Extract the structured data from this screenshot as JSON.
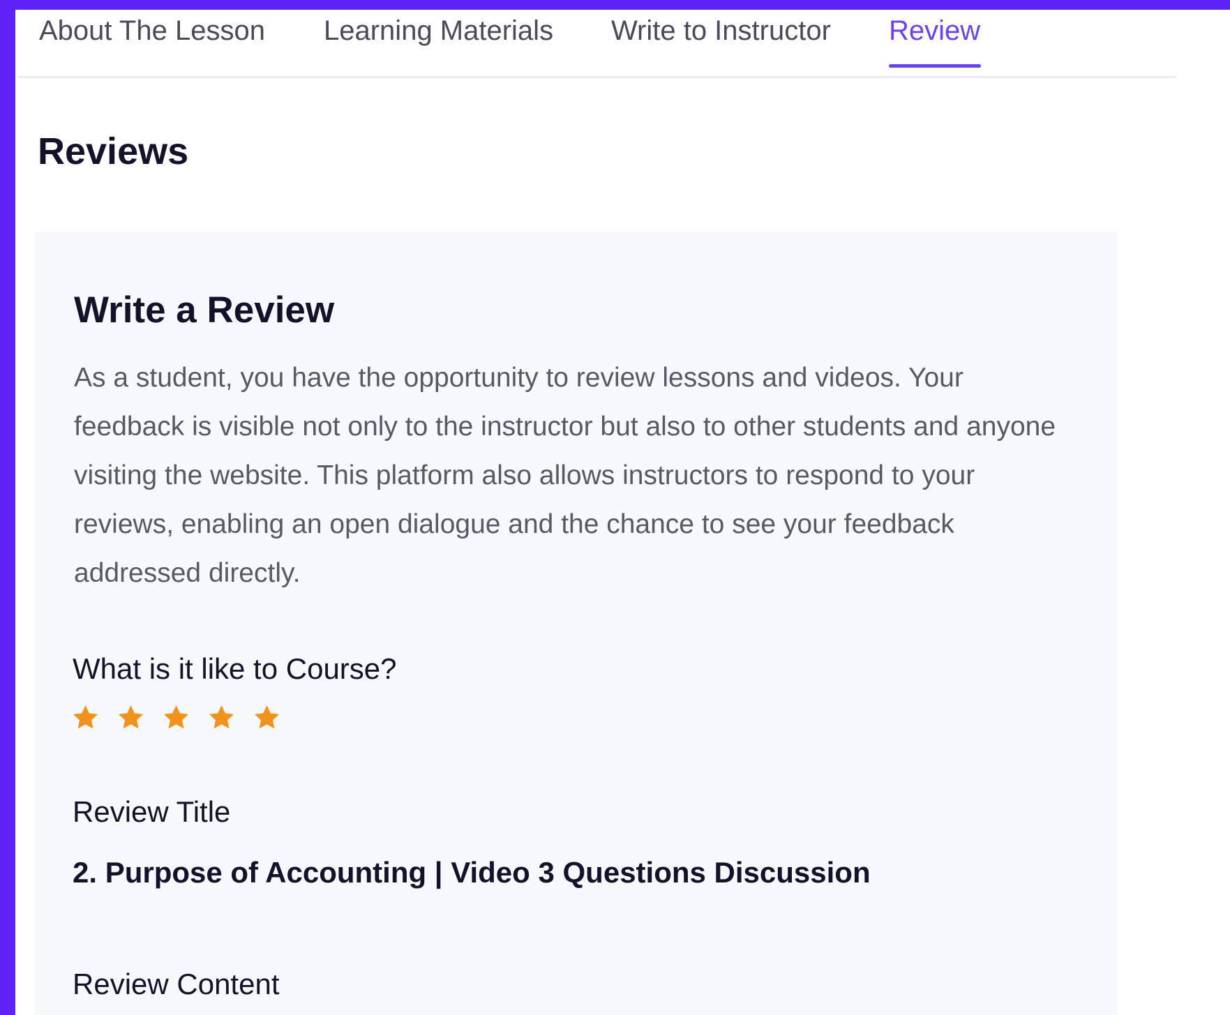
{
  "theme": {
    "accent": "#6a42f0",
    "frame": "#5b21f5",
    "star": "#f0921c",
    "card_bg": "#f7f8fc"
  },
  "tabs": [
    {
      "label": "About The Lesson",
      "active": false
    },
    {
      "label": "Learning Materials",
      "active": false
    },
    {
      "label": "Write to Instructor",
      "active": false
    },
    {
      "label": "Review",
      "active": true
    }
  ],
  "page": {
    "title": "Reviews"
  },
  "review_form": {
    "title": "Write a Review",
    "description": "As a student, you have the opportunity to review lessons and videos. Your feedback is visible not only to the instructor but also to other students and anyone visiting the website. This platform also allows instructors to respond to your reviews, enabling an open dialogue and the chance to see your feedback addressed directly.",
    "rating_label": "What is it like to Course?",
    "rating": {
      "value": 5,
      "max": 5,
      "icon": "star-icon"
    },
    "review_title_label": "Review Title",
    "review_title_value": "2. Purpose of Accounting | Video 3 Questions Discussion",
    "review_content_label": "Review Content"
  }
}
